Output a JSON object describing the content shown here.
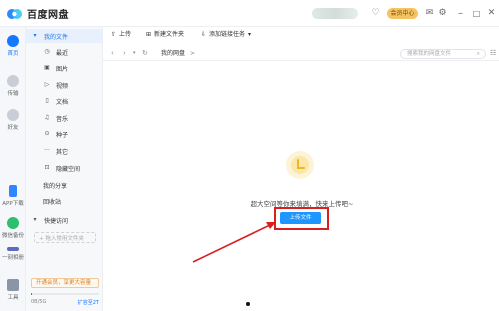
{
  "app": {
    "title": "百度网盘"
  },
  "topbar": {
    "vip_label": "会员中心"
  },
  "rail": {
    "items": [
      {
        "label": "首页",
        "icon": "home-cloud-icon",
        "active": true
      },
      {
        "label": "传输",
        "icon": "transfer-icon",
        "active": false
      },
      {
        "label": "好友",
        "icon": "friends-icon",
        "active": false
      },
      {
        "label": "APP下载",
        "icon": "app-download-icon",
        "active": false
      },
      {
        "label": "微信备份",
        "icon": "wechat-backup-icon",
        "active": false
      },
      {
        "label": "一刻相册",
        "icon": "album-icon",
        "active": false
      },
      {
        "label": "工具",
        "icon": "tools-icon",
        "active": false
      }
    ]
  },
  "nav": {
    "my_files": "我的文件",
    "categories": [
      {
        "label": "最近",
        "icon": "clock-icon"
      },
      {
        "label": "图片",
        "icon": "image-icon"
      },
      {
        "label": "视频",
        "icon": "video-icon"
      },
      {
        "label": "文档",
        "icon": "document-icon"
      },
      {
        "label": "音乐",
        "icon": "music-icon"
      },
      {
        "label": "种子",
        "icon": "seed-icon"
      },
      {
        "label": "其它",
        "icon": "more-icon"
      },
      {
        "label": "隐藏空间",
        "icon": "lock-icon"
      }
    ],
    "my_share": "我的分享",
    "recycle_bin": "回收站",
    "quick_access": "快捷访问",
    "add_frequent": "+ 拖入常用文件夹",
    "vip_banner": "开通会员，享更大容量",
    "storage_text": "0B/5G",
    "storage_used_fraction": 0.0,
    "expand_text": "扩容至2T"
  },
  "toolbar": {
    "upload": "上传",
    "new_folder": "新建文件夹",
    "add_link_task": "添加链接任务"
  },
  "pathbar": {
    "current": "我的网盘",
    "separator": ">",
    "search_placeholder": "搜索我的网盘文件"
  },
  "empty_state": {
    "message": "超大空间等你来填满，快来上传吧~",
    "upload_button": "上传文件"
  },
  "colors": {
    "accent": "#1e96ff",
    "annotation": "#d82020",
    "vip": "#f4c463"
  }
}
